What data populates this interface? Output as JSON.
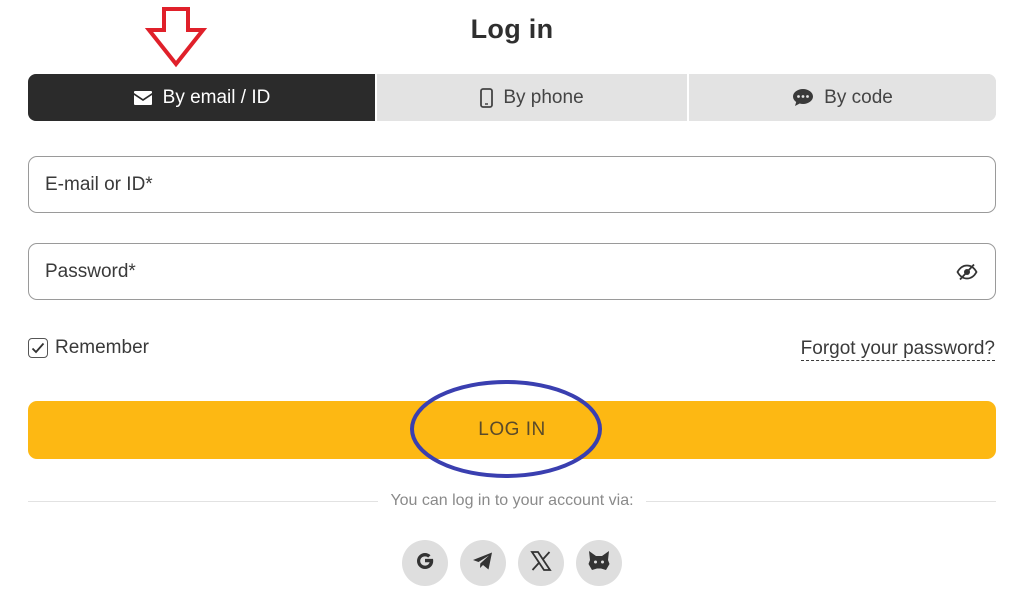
{
  "page": {
    "title": "Log in"
  },
  "tabs": [
    {
      "label": "By email / ID",
      "icon": "envelope-icon",
      "active": true
    },
    {
      "label": "By phone",
      "icon": "phone-icon",
      "active": false
    },
    {
      "label": "By code",
      "icon": "chat-icon",
      "active": false
    }
  ],
  "form": {
    "email_placeholder": "E-mail or ID*",
    "email_value": "",
    "password_placeholder": "Password*",
    "password_value": "",
    "remember_label": "Remember",
    "remember_checked": true,
    "forgot_label": "Forgot your password?",
    "submit_label": "LOG IN"
  },
  "social": {
    "caption": "You can log in to your account via:",
    "providers": [
      "google-icon",
      "telegram-icon",
      "x-icon",
      "metamask-icon"
    ]
  },
  "colors": {
    "primary_button": "#fdb813",
    "active_tab": "#2b2b2b",
    "inactive_tab": "#e3e3e3",
    "annotation_arrow": "#e0202a",
    "annotation_circle": "#3a3fb0"
  }
}
